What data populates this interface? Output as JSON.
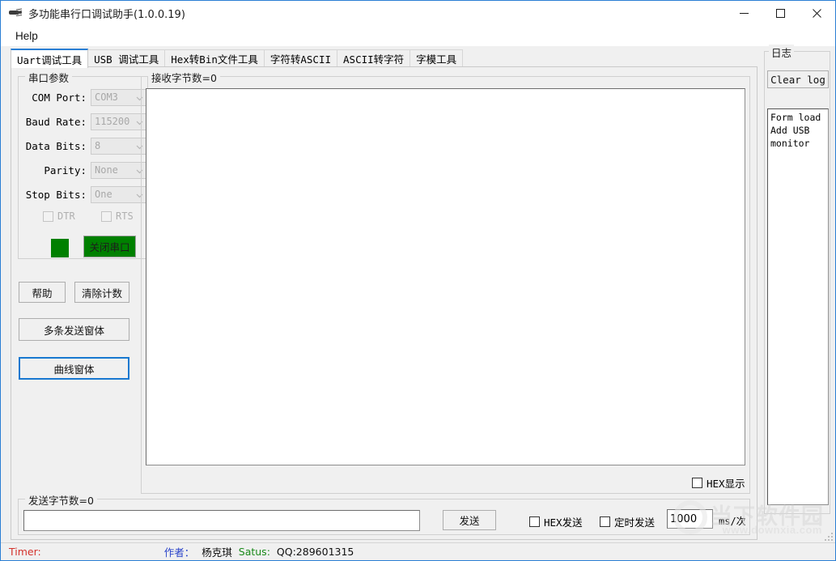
{
  "window": {
    "title": "多功能串行口调试助手(1.0.0.19)",
    "icon": "serial-plug-icon",
    "minimize_label": "─",
    "maximize_label": "□",
    "close_label": "✕"
  },
  "menubar": {
    "items": [
      {
        "label": "Help",
        "name": "menu-help"
      }
    ]
  },
  "tabs": [
    {
      "label": "Uart调试工具",
      "name": "tab-uart",
      "active": true
    },
    {
      "label": "USB 调试工具",
      "name": "tab-usb",
      "active": false
    },
    {
      "label": "Hex转Bin文件工具",
      "name": "tab-hex2bin",
      "active": false
    },
    {
      "label": "字符转ASCII",
      "name": "tab-char2ascii",
      "active": false
    },
    {
      "label": "ASCII转字符",
      "name": "tab-ascii2char",
      "active": false
    },
    {
      "label": "字模工具",
      "name": "tab-font",
      "active": false
    }
  ],
  "serial_params": {
    "legend": "串口参数",
    "fields": [
      {
        "label": "COM Port:",
        "value": "COM3",
        "name": "com-port"
      },
      {
        "label": "Baud Rate:",
        "value": "115200",
        "name": "baud-rate"
      },
      {
        "label": "Data Bits:",
        "value": "8",
        "name": "data-bits"
      },
      {
        "label": "Parity:",
        "value": "None",
        "name": "parity"
      },
      {
        "label": "Stop Bits:",
        "value": "One",
        "name": "stop-bits"
      }
    ],
    "dtr_label": "DTR",
    "rts_label": "RTS",
    "dtr_checked": false,
    "rts_checked": false,
    "led_color": "#008000",
    "toggle_button_label": "关闭串口",
    "toggle_button_color": "#008000"
  },
  "left_buttons": {
    "help": "帮助",
    "clear_count": "清除计数",
    "multi_send": "多条发送窗体",
    "curve_window": "曲线窗体"
  },
  "receive": {
    "legend": "接收字节数=0",
    "content": "",
    "hex_display_label": "HEX显示",
    "hex_display_checked": false
  },
  "send": {
    "legend": "发送字节数=0",
    "input_value": "",
    "input_placeholder": "",
    "send_button_label": "发送",
    "hex_send_label": "HEX发送",
    "hex_send_checked": false,
    "timed_send_label": "定时发送",
    "timed_send_checked": false,
    "interval_value": "1000",
    "interval_unit": "ms/次"
  },
  "log": {
    "legend": "日志",
    "clear_button_label": "Clear log",
    "lines": [
      "Form load",
      "Add USB",
      "monitor"
    ]
  },
  "statusbar": {
    "timer_label": "Timer:",
    "author_label": "作者：",
    "author_name": "杨克琪",
    "status_label": "Satus:",
    "qq": "QQ:289601315",
    "colors": {
      "timer": "#d4322c",
      "author_label": "#2a43c9",
      "status_label": "#1a8a1a"
    }
  },
  "watermark": {
    "cn": "当下软件园",
    "url": "www.downxia.com"
  }
}
